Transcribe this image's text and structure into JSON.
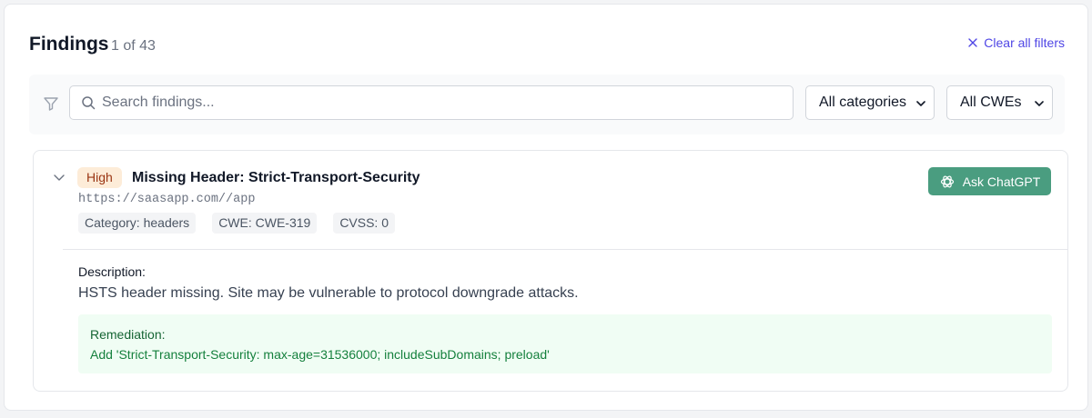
{
  "header": {
    "title": "Findings",
    "count": "1 of 43",
    "clear_filters": "Clear all filters"
  },
  "filters": {
    "search_placeholder": "Search findings...",
    "search_value": "",
    "category_selected": "All categories",
    "cwe_selected": "All CWEs"
  },
  "finding": {
    "severity": "High",
    "title": "Missing Header: Strict-Transport-Security",
    "url": "https://saasapp.com//app",
    "chips": {
      "category": "Category: headers",
      "cwe": "CWE: CWE-319",
      "cvss": "CVSS: 0"
    },
    "ask_button": "Ask ChatGPT",
    "description_label": "Description:",
    "description": "HSTS header missing. Site may be vulnerable to protocol downgrade attacks.",
    "remediation_label": "Remediation:",
    "remediation": "Add 'Strict-Transport-Security: max-age=31536000; includeSubDomains; preload'"
  },
  "colors": {
    "accent": "#4f46e5",
    "severity_high_bg": "#fdecd8",
    "severity_high_text": "#9a3412",
    "ask_button_bg": "#4a9d80",
    "remediation_bg": "#f0fdf4"
  },
  "icons": {
    "filter": "filter-icon",
    "search": "search-icon",
    "clear": "close-icon",
    "expand": "chevron-down-icon",
    "ask": "chatgpt-icon"
  }
}
